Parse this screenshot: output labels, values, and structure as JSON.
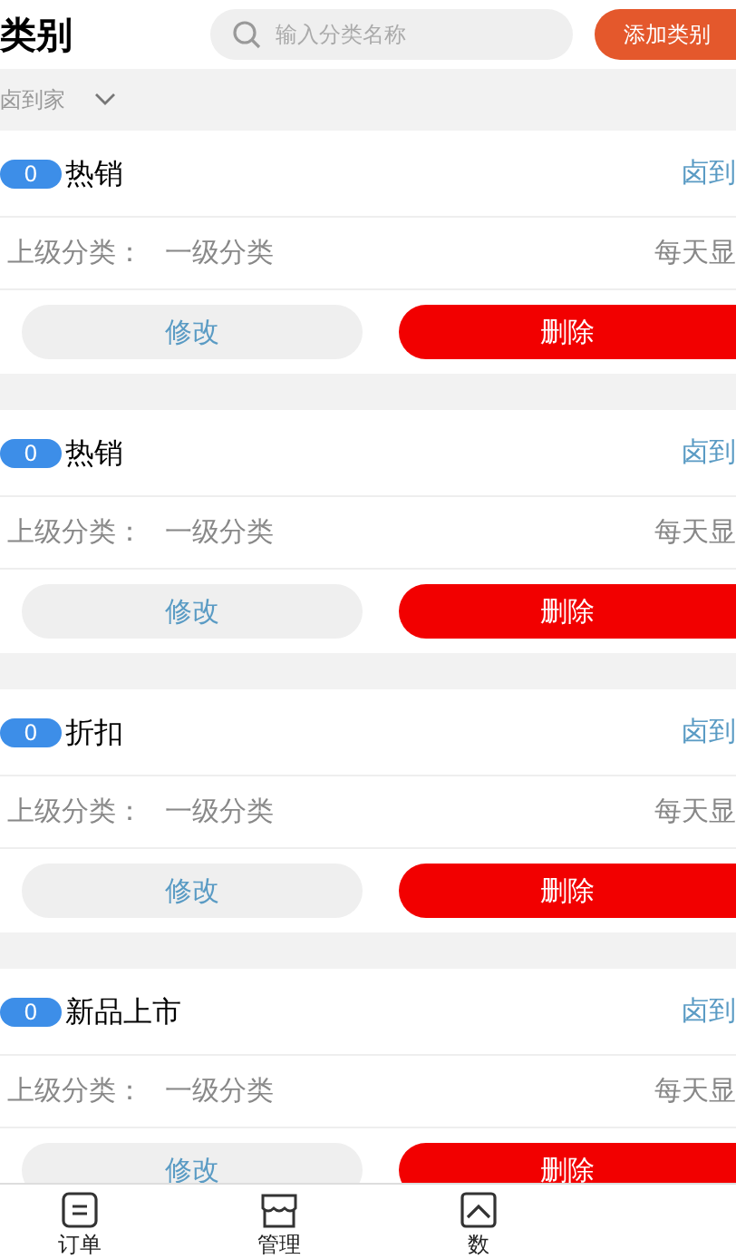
{
  "header": {
    "title": "类别",
    "search": {
      "placeholder": "输入分类名称"
    },
    "add_button": "添加类别"
  },
  "filter": {
    "label": "卤到家"
  },
  "categories": [
    {
      "count": "0",
      "name": "热销",
      "store": "卤到",
      "parent_label": "上级分类：",
      "parent": "一级分类",
      "display": "每天显",
      "edit": "修改",
      "delete": "删除"
    },
    {
      "count": "0",
      "name": "热销",
      "store": "卤到",
      "parent_label": "上级分类：",
      "parent": "一级分类",
      "display": "每天显",
      "edit": "修改",
      "delete": "删除"
    },
    {
      "count": "0",
      "name": "折扣",
      "store": "卤到",
      "parent_label": "上级分类：",
      "parent": "一级分类",
      "display": "每天显",
      "edit": "修改",
      "delete": "删除"
    },
    {
      "count": "0",
      "name": "新品上市",
      "store": "卤到",
      "parent_label": "上级分类：",
      "parent": "一级分类",
      "display": "每天显",
      "edit": "修改",
      "delete": "删除"
    }
  ],
  "tab_bar": [
    {
      "kind": "order",
      "label": "订单"
    },
    {
      "kind": "manage",
      "label": "管理"
    },
    {
      "kind": "data",
      "label": "数"
    }
  ]
}
